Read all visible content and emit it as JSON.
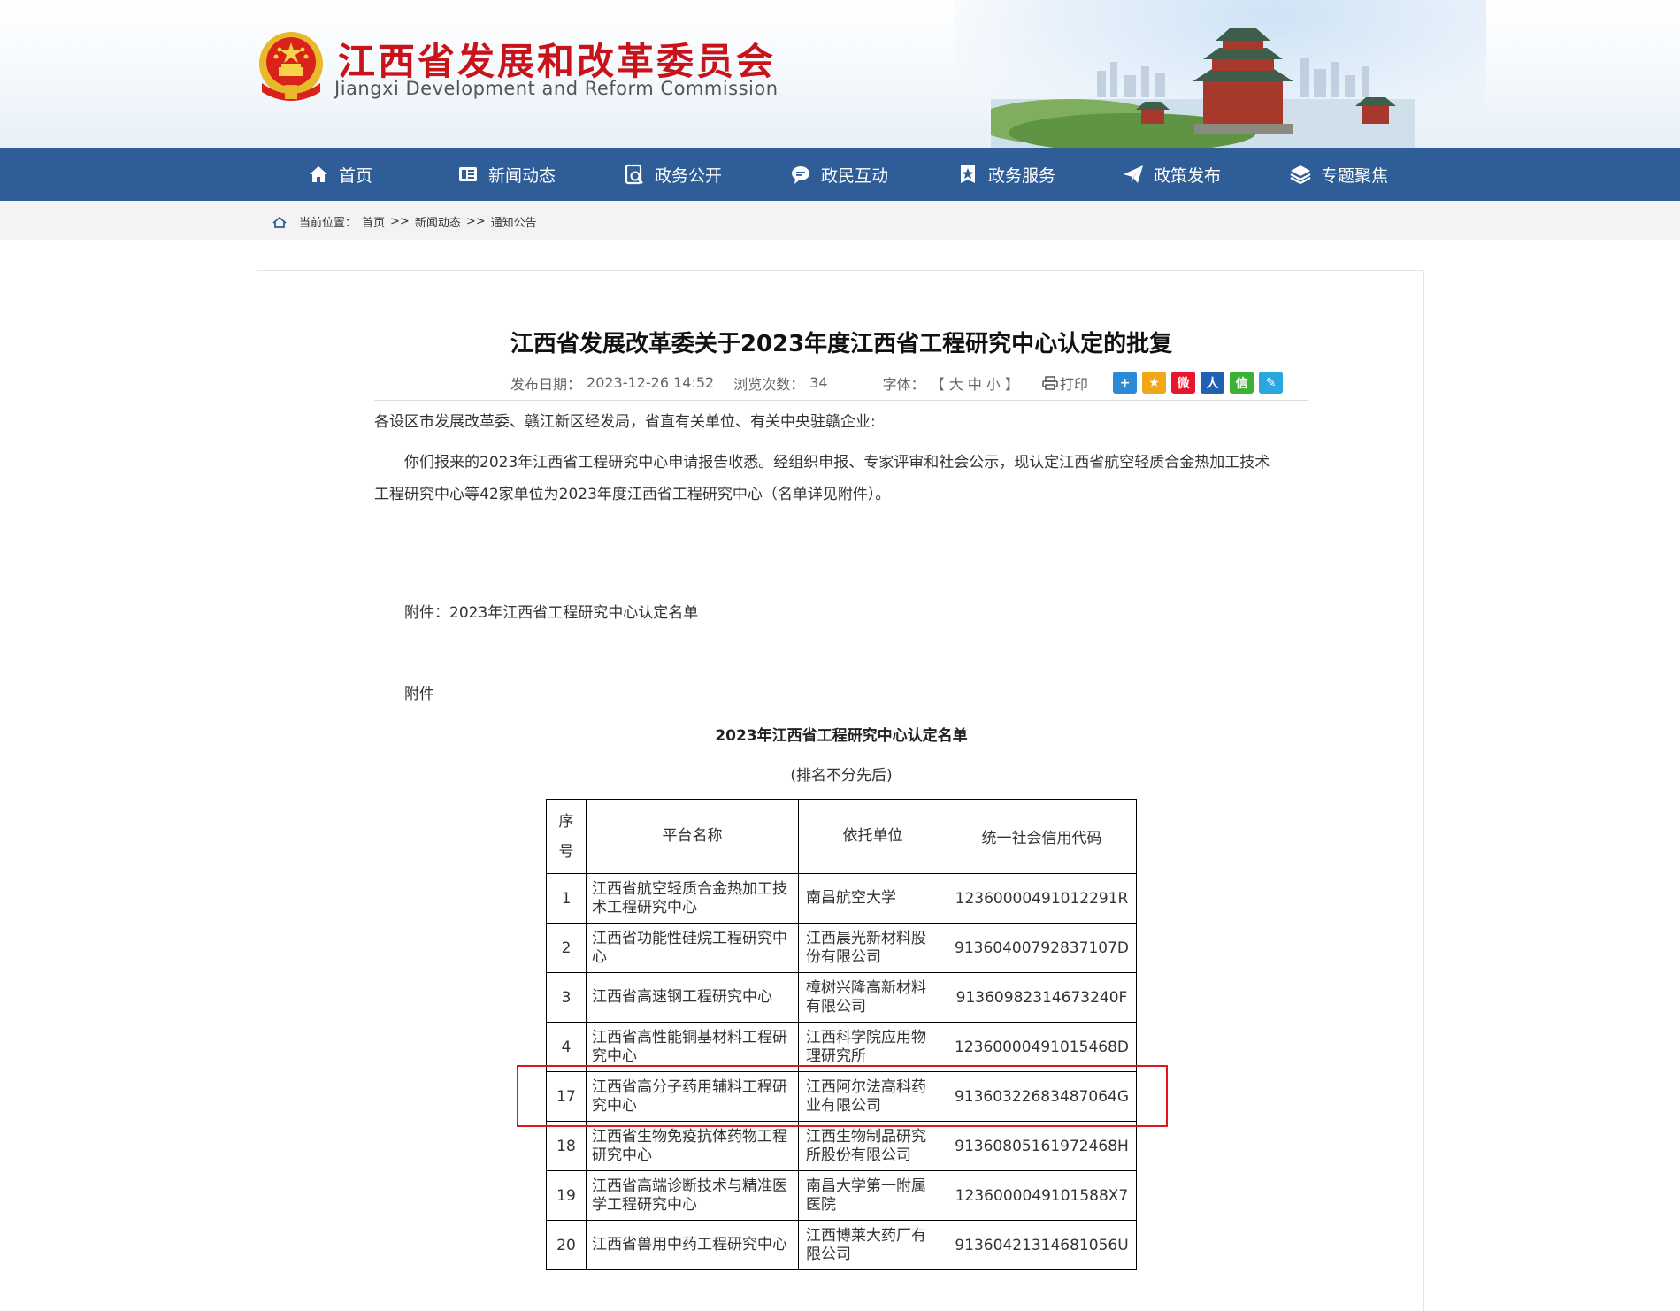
{
  "site": {
    "title": "江西省发展和改革委员会",
    "subtitle": "Jiangxi Development and Reform Commission"
  },
  "nav": {
    "items": [
      {
        "label": "首页",
        "icon": "home-icon"
      },
      {
        "label": "新闻动态",
        "icon": "news-icon"
      },
      {
        "label": "政务公开",
        "icon": "search-doc-icon"
      },
      {
        "label": "政民互动",
        "icon": "chat-icon"
      },
      {
        "label": "政务服务",
        "icon": "star-doc-icon"
      },
      {
        "label": "政策发布",
        "icon": "paper-plane-icon"
      },
      {
        "label": "专题聚焦",
        "icon": "layers-icon"
      }
    ]
  },
  "breadcrumb": {
    "prefix": "当前位置：",
    "items": [
      "首页",
      "新闻动态",
      "通知公告"
    ],
    "separator": ">>"
  },
  "article": {
    "title": "江西省发展改革委关于2023年度江西省工程研究中心认定的批复",
    "publish_label": "发布日期：",
    "publish_date": "2023-12-26 14:52",
    "views_label": "浏览次数：",
    "views": "34",
    "font_label": "字体：",
    "font_open": "【",
    "font_large": "大",
    "font_medium": "中",
    "font_small": "小",
    "font_close": "】",
    "print_label": "打印",
    "salutation": "各设区市发展改革委、赣江新区经发局，省直有关单位、有关中央驻赣企业:",
    "body_line1": "你们报来的2023年江西省工程研究中心申请报告收悉。经组织申报、专家评审和社会公示，现认定江西省航空轻质合金热加工技术",
    "body_line2": "工程研究中心等42家单位为2023年度江西省工程研究中心（名单详见附件）。",
    "attachment_line": "附件：2023年江西省工程研究中心认定名单",
    "attachment_heading": "附件",
    "table_title": "2023年江西省工程研究中心认定名单",
    "table_subtitle": "(排名不分先后)"
  },
  "share_icons": [
    {
      "name": "share-more-icon",
      "color": "#2a8ad8",
      "glyph": "+"
    },
    {
      "name": "qzone-icon",
      "color": "#f0a818",
      "glyph": "★"
    },
    {
      "name": "weibo-icon",
      "color": "#e6162d",
      "glyph": "微"
    },
    {
      "name": "renren-icon",
      "color": "#1f62b3",
      "glyph": "人"
    },
    {
      "name": "wechat-icon",
      "color": "#3cb035",
      "glyph": "信"
    },
    {
      "name": "edit-icon",
      "color": "#2aa7e0",
      "glyph": "✎"
    }
  ],
  "table": {
    "headers": [
      "序号",
      "平台名称",
      "依托单位",
      "统一社会信用代码"
    ],
    "rows": [
      {
        "no": "1",
        "name": "江西省航空轻质合金热加工技术工程研究中心",
        "unit": "南昌航空大学",
        "code": "12360000491012291R"
      },
      {
        "no": "2",
        "name": "江西省功能性硅烷工程研究中心",
        "unit": "江西晨光新材料股份有限公司",
        "code": "91360400792837107D"
      },
      {
        "no": "3",
        "name": "江西省高速钢工程研究中心",
        "unit": "樟树兴隆高新材料有限公司",
        "code": "91360982314673240F"
      },
      {
        "no": "4",
        "name": "江西省高性能铜基材料工程研究中心",
        "unit": "江西科学院应用物理研究所",
        "code": "12360000491015468D"
      },
      {
        "no": "17",
        "name": "江西省高分子药用辅料工程研究中心",
        "unit": "江西阿尔法高科药业有限公司",
        "code": "91360322683487064G"
      },
      {
        "no": "18",
        "name": "江西省生物免疫抗体药物工程研究中心",
        "unit": "江西生物制品研究所股份有限公司",
        "code": "91360805161972468H"
      },
      {
        "no": "19",
        "name": "江西省高端诊断技术与精准医学工程研究中心",
        "unit": "南昌大学第一附属医院",
        "code": "1236000049101588X7"
      },
      {
        "no": "20",
        "name": "江西省兽用中药工程研究中心",
        "unit": "江西博莱大药厂有限公司",
        "code": "91360421314681056U"
      }
    ]
  },
  "colors": {
    "nav_bg": "#2f5d97",
    "title_red": "#c7131a",
    "highlight_border": "#e2141c"
  }
}
